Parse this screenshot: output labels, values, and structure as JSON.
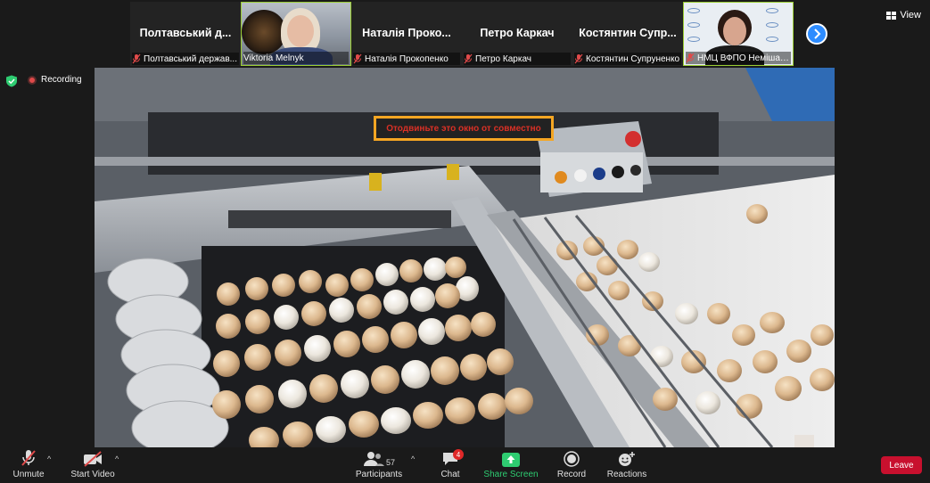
{
  "gallery": {
    "tiles": [
      {
        "name_big": "Полтавський д...",
        "label": "Полтавський держав...",
        "muted": true
      },
      {
        "name_big": "",
        "label": "Viktoria Melnyk",
        "muted": false
      },
      {
        "name_big": "Наталія Проко...",
        "label": "Наталія Прокопенко",
        "muted": true
      },
      {
        "name_big": "Петро Каркач",
        "label": "Петро Каркач",
        "muted": true
      },
      {
        "name_big": "Костянтин Супр...",
        "label": "Костянтин Супруненко",
        "muted": true
      },
      {
        "name_big": "",
        "label": "НМЦ ВФПО Немішає...",
        "muted": true
      }
    ]
  },
  "view": {
    "label": "View"
  },
  "status": {
    "recording_label": "Recording"
  },
  "share_banner": {
    "text": "Отодвиньте это окно от совместно"
  },
  "toolbar": {
    "unmute_label": "Unmute",
    "start_video_label": "Start Video",
    "participants_label": "Participants",
    "participants_count": "57",
    "chat_label": "Chat",
    "chat_badge": "4",
    "share_screen_label": "Share Screen",
    "record_label": "Record",
    "reactions_label": "Reactions",
    "leave_label": "Leave"
  },
  "colors": {
    "accent_green": "#2ecc71",
    "active_speaker": "#9acd32",
    "leave_red": "#c8102e",
    "zoom_blue": "#2d8cff",
    "banner_border": "#f5a623",
    "banner_text": "#d93025"
  }
}
